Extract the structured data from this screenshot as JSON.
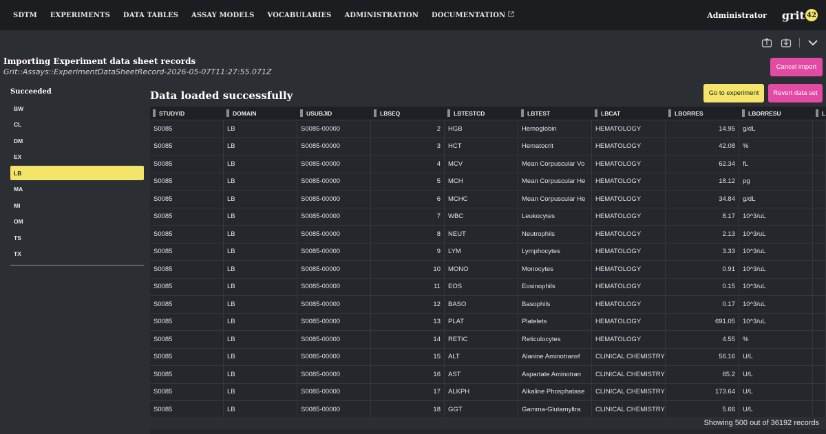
{
  "nav": {
    "items": [
      "SDTM",
      "EXPERIMENTS",
      "DATA TABLES",
      "ASSAY MODELS",
      "VOCABULARIES",
      "ADMINISTRATION",
      "DOCUMENTATION"
    ],
    "user": "Administrator",
    "logo_text": "grit",
    "logo_badge": "42"
  },
  "toolbar": {
    "icons": [
      "upload-icon",
      "download-icon",
      "chevron-down-icon"
    ]
  },
  "import": {
    "title": "Importing Experiment data sheet records",
    "subtitle": "Grit::Assays::ExperimentDataSheetRecord-2026-05-07T11:27:55.071Z",
    "cancel_label": "Cancel import"
  },
  "sidebar": {
    "title": "Succeeded",
    "items": [
      "BW",
      "CL",
      "DM",
      "EX",
      "LB",
      "MA",
      "MI",
      "OM",
      "TS",
      "TX"
    ],
    "active": "LB"
  },
  "main": {
    "title": "Data loaded successfully",
    "goto_label": "Go to experiment",
    "revert_label": "Revert data set",
    "status": "Showing 500 out of 36192 records"
  },
  "colors": {
    "accent_yellow": "#f4e56a",
    "accent_pink": "#e24aa4",
    "nav_bg": "#1b1d20",
    "page_bg": "#2b2e33"
  },
  "table": {
    "columns": [
      "STUDYID",
      "DOMAIN",
      "USUBJID",
      "LBSEQ",
      "LBTESTCD",
      "LBTEST",
      "LBCAT",
      "LBORRES",
      "LBORRESU",
      "L"
    ],
    "rows": [
      [
        "S0085",
        "LB",
        "S0085-00000",
        "2",
        "HGB",
        "Hemoglobin",
        "HEMATOLOGY",
        "14.95",
        "g/dL"
      ],
      [
        "S0085",
        "LB",
        "S0085-00000",
        "3",
        "HCT",
        "Hematocrit",
        "HEMATOLOGY",
        "42.08",
        "%"
      ],
      [
        "S0085",
        "LB",
        "S0085-00000",
        "4",
        "MCV",
        "Mean Corpuscular Vo",
        "HEMATOLOGY",
        "62.34",
        "fL"
      ],
      [
        "S0085",
        "LB",
        "S0085-00000",
        "5",
        "MCH",
        "Mean Corpuscular He",
        "HEMATOLOGY",
        "18.12",
        "pg"
      ],
      [
        "S0085",
        "LB",
        "S0085-00000",
        "6",
        "MCHC",
        "Mean Corpuscular He",
        "HEMATOLOGY",
        "34.84",
        "g/dL"
      ],
      [
        "S0085",
        "LB",
        "S0085-00000",
        "7",
        "WBC",
        "Leukocytes",
        "HEMATOLOGY",
        "8.17",
        "10^3/uL"
      ],
      [
        "S0085",
        "LB",
        "S0085-00000",
        "8",
        "NEUT",
        "Neutrophils",
        "HEMATOLOGY",
        "2.13",
        "10^3/uL"
      ],
      [
        "S0085",
        "LB",
        "S0085-00000",
        "9",
        "LYM",
        "Lymphocytes",
        "HEMATOLOGY",
        "3.33",
        "10^3/uL"
      ],
      [
        "S0085",
        "LB",
        "S0085-00000",
        "10",
        "MONO",
        "Monocytes",
        "HEMATOLOGY",
        "0.91",
        "10^3/uL"
      ],
      [
        "S0085",
        "LB",
        "S0085-00000",
        "11",
        "EOS",
        "Eosinophils",
        "HEMATOLOGY",
        "0.15",
        "10^3/uL"
      ],
      [
        "S0085",
        "LB",
        "S0085-00000",
        "12",
        "BASO",
        "Basophils",
        "HEMATOLOGY",
        "0.17",
        "10^3/uL"
      ],
      [
        "S0085",
        "LB",
        "S0085-00000",
        "13",
        "PLAT",
        "Platelets",
        "HEMATOLOGY",
        "691.05",
        "10^3/uL"
      ],
      [
        "S0085",
        "LB",
        "S0085-00000",
        "14",
        "RETIC",
        "Reticulocytes",
        "HEMATOLOGY",
        "4.55",
        "%"
      ],
      [
        "S0085",
        "LB",
        "S0085-00000",
        "15",
        "ALT",
        "Alanine Aminotransf",
        "CLINICAL CHEMISTRY",
        "56.16",
        "U/L"
      ],
      [
        "S0085",
        "LB",
        "S0085-00000",
        "16",
        "AST",
        "Aspartate Aminotran",
        "CLINICAL CHEMISTRY",
        "65.2",
        "U/L"
      ],
      [
        "S0085",
        "LB",
        "S0085-00000",
        "17",
        "ALKPH",
        "Alkaline Phosphatase",
        "CLINICAL CHEMISTRY",
        "173.64",
        "U/L"
      ],
      [
        "S0085",
        "LB",
        "S0085-00000",
        "18",
        "GGT",
        "Gamma-Glutamyltra",
        "CLINICAL CHEMISTRY",
        "5.66",
        "U/L"
      ]
    ]
  }
}
